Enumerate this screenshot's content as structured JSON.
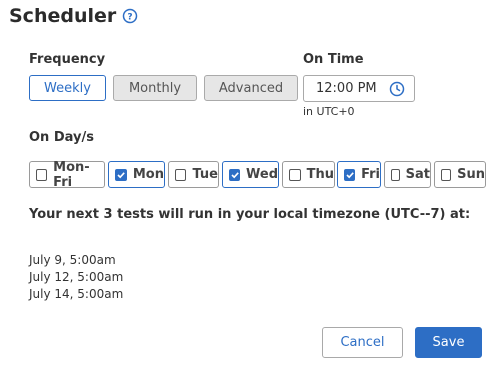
{
  "title": "Scheduler",
  "frequency": {
    "label": "Frequency",
    "options": [
      "Weekly",
      "Monthly",
      "Advanced"
    ],
    "selected": "Weekly"
  },
  "on_time": {
    "label": "On Time",
    "value": "12:00 PM",
    "timezone_note": "in UTC+0"
  },
  "days": {
    "label": "On Day/s",
    "items": [
      {
        "label": "Mon-Fri",
        "checked": false
      },
      {
        "label": "Mon",
        "checked": true
      },
      {
        "label": "Tue",
        "checked": false
      },
      {
        "label": "Wed",
        "checked": true
      },
      {
        "label": "Thu",
        "checked": false
      },
      {
        "label": "Fri",
        "checked": true
      },
      {
        "label": "Sat",
        "checked": false
      },
      {
        "label": "Sun",
        "checked": false
      }
    ]
  },
  "next_runs": {
    "heading": "Your next 3 tests will run in your local timezone (UTC--7) at:",
    "runs": [
      "July 9, 5:00am",
      "July 12, 5:00am",
      "July 14, 5:00am"
    ]
  },
  "actions": {
    "cancel_label": "Cancel",
    "save_label": "Save"
  },
  "colors": {
    "accent": "#2d6ec5",
    "inactive_bg": "#e6e6e6"
  }
}
